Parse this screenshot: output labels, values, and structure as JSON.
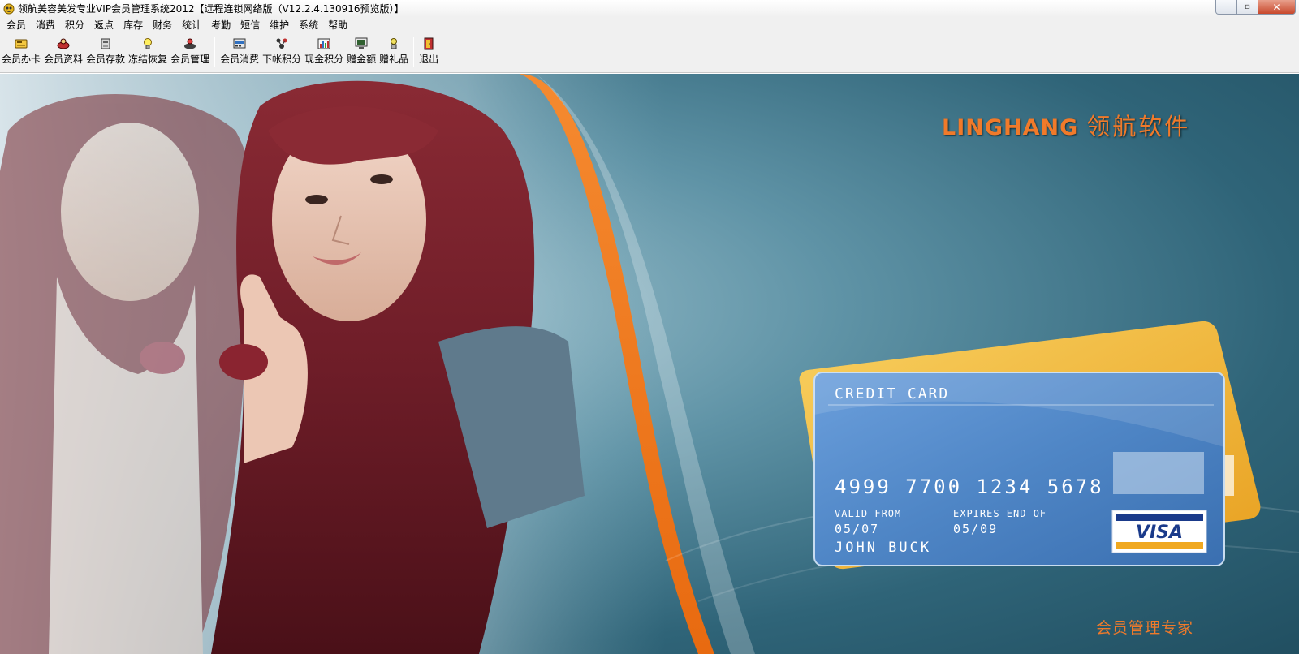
{
  "window": {
    "title": "领航美容美发专业VIP会员管理系统2012【远程连锁网络版（V12.2.4.130916预览版）】",
    "min_glyph": "─",
    "max_glyph": "▫",
    "close_glyph": "✕"
  },
  "menu": [
    "会员",
    "消费",
    "积分",
    "返点",
    "库存",
    "财务",
    "统计",
    "考勤",
    "短信",
    "维护",
    "系统",
    "帮助"
  ],
  "toolbar": {
    "group1": [
      {
        "label": "会员办卡",
        "icon": "new-card-icon"
      },
      {
        "label": "会员资料",
        "icon": "member-info-icon"
      },
      {
        "label": "会员存款",
        "icon": "deposit-icon"
      },
      {
        "label": "冻结恢复",
        "icon": "lightbulb-icon"
      },
      {
        "label": "会员管理",
        "icon": "member-manage-icon"
      }
    ],
    "group2": [
      {
        "label": "会员消费",
        "icon": "consume-icon"
      },
      {
        "label": "下帐积分",
        "icon": "points-icon"
      },
      {
        "label": "现金积分",
        "icon": "cash-points-icon"
      },
      {
        "label": "赠金额",
        "icon": "monitor-icon"
      },
      {
        "label": "赠礼品",
        "icon": "gift-icon"
      }
    ],
    "group3": [
      {
        "label": "退出",
        "icon": "exit-door-icon"
      }
    ]
  },
  "splash": {
    "brand_en": "LINGHANG",
    "brand_cn": "领航软件",
    "slogan": "会员管理专家",
    "card": {
      "title": "CREDIT CARD",
      "number": "4999 7700 1234 5678",
      "valid_from_label": "VALID FROM",
      "expires_label": "EXPIRES END OF",
      "valid_from": "05/07",
      "expires": "05/09",
      "holder": "JOHN BUCK",
      "brand": "VISA"
    }
  },
  "colors": {
    "accent_orange": "#f07a2a",
    "card_blue": "#4f86c6",
    "card_yellow": "#f2b83a",
    "bg_teal": "#2f6478"
  }
}
